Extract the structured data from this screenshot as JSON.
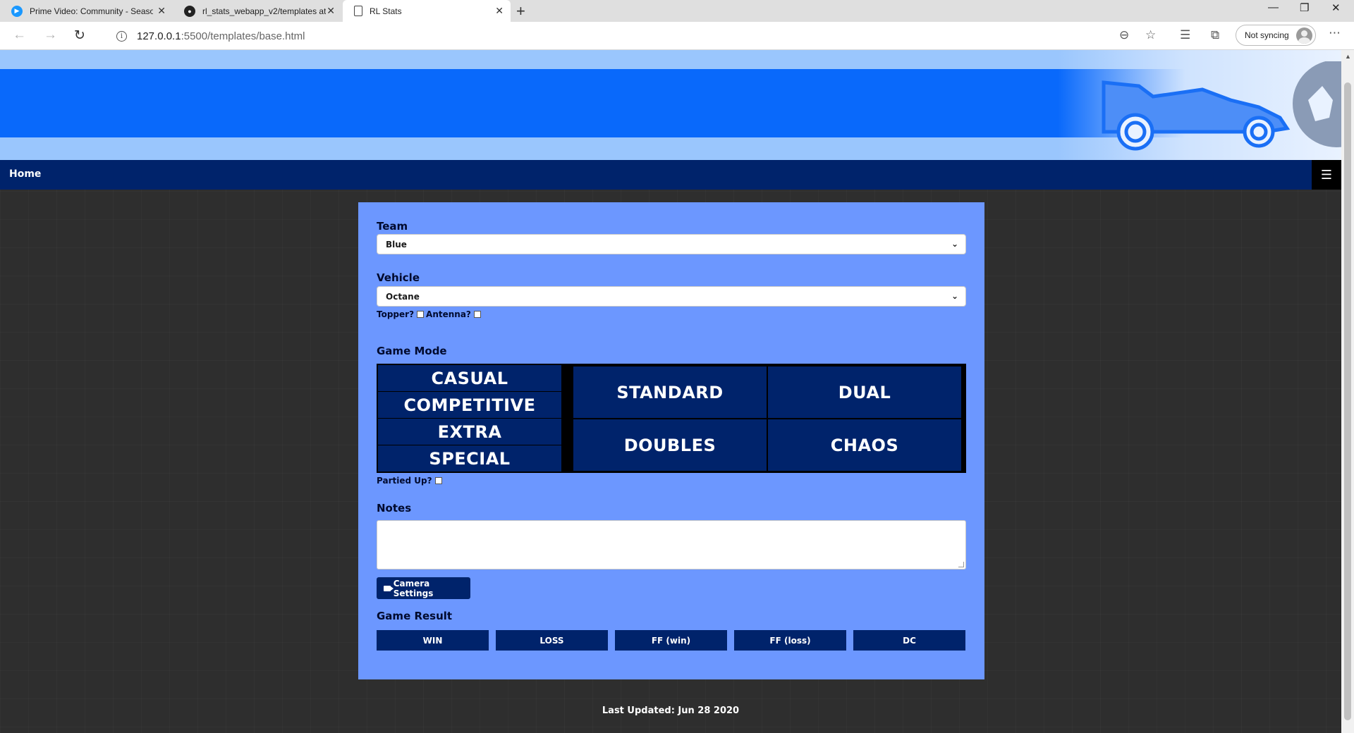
{
  "browser": {
    "tabs": [
      {
        "title": "Prime Video: Community - Seaso",
        "icon": "prime-video-icon"
      },
      {
        "title": "rl_stats_webapp_v2/templates at",
        "icon": "github-icon"
      },
      {
        "title": "RL Stats",
        "icon": "page-icon"
      }
    ],
    "url_host": "127.0.0.1",
    "url_path": ":5500/templates/base.html",
    "sync_label": "Not syncing"
  },
  "nav": {
    "home": "Home"
  },
  "form": {
    "team_label": "Team",
    "team_value": "Blue",
    "vehicle_label": "Vehicle",
    "vehicle_value": "Octane",
    "topper_label": "Topper?",
    "antenna_label": "Antenna?",
    "game_mode_label": "Game Mode",
    "playlists": [
      "CASUAL",
      "COMPETITIVE",
      "EXTRA",
      "SPECIAL"
    ],
    "modes": [
      "STANDARD",
      "DUAL",
      "DOUBLES",
      "CHAOS"
    ],
    "partied_label": "Partied Up?",
    "notes_label": "Notes",
    "camera_button": "Camera Settings",
    "game_result_label": "Game Result",
    "results": [
      "WIN",
      "LOSS",
      "FF (win)",
      "FF (loss)",
      "DC"
    ]
  },
  "footer": {
    "last_updated": "Last Updated: Jun 28 2020"
  },
  "colors": {
    "navy": "#00236b",
    "card": "#6c97ff",
    "banner_band": "#0969fb",
    "banner_light": "#9ac6fd"
  }
}
